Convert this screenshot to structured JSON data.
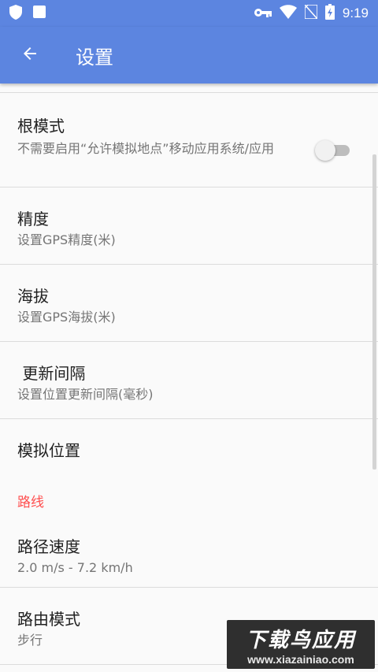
{
  "status": {
    "time": "9:19",
    "icons": [
      "shield-icon",
      "square-icon",
      "key-icon",
      "wifi-icon",
      "no-sim-icon",
      "battery-charging-icon"
    ]
  },
  "app_bar": {
    "title": "设置",
    "back_icon": "arrow-left-icon"
  },
  "settings": {
    "root_mode": {
      "title": "根模式",
      "summary": "不需要启用“允许模拟地点”移动应用系统/应用",
      "enabled": false
    },
    "accuracy": {
      "title": "精度",
      "summary": "设置GPS精度(米)"
    },
    "altitude": {
      "title": "海拔",
      "summary": "设置GPS海拔(米)"
    },
    "update_interval": {
      "title": " 更新间隔",
      "summary": "设置位置更新间隔(毫秒)"
    },
    "mock_location": {
      "title": "模拟位置"
    }
  },
  "route_section": {
    "header": "路线",
    "route_speed": {
      "title": "路径速度",
      "summary": "2.0 m/s - 7.2 km/h"
    },
    "routing_mode": {
      "title": "路由模式",
      "summary": "步行"
    }
  },
  "watermark": {
    "top": "下载鸟应用",
    "bottom": "www.xiazainiao.com"
  },
  "colors": {
    "primary": "#5c85e0",
    "accent": "#ff4f4f"
  }
}
